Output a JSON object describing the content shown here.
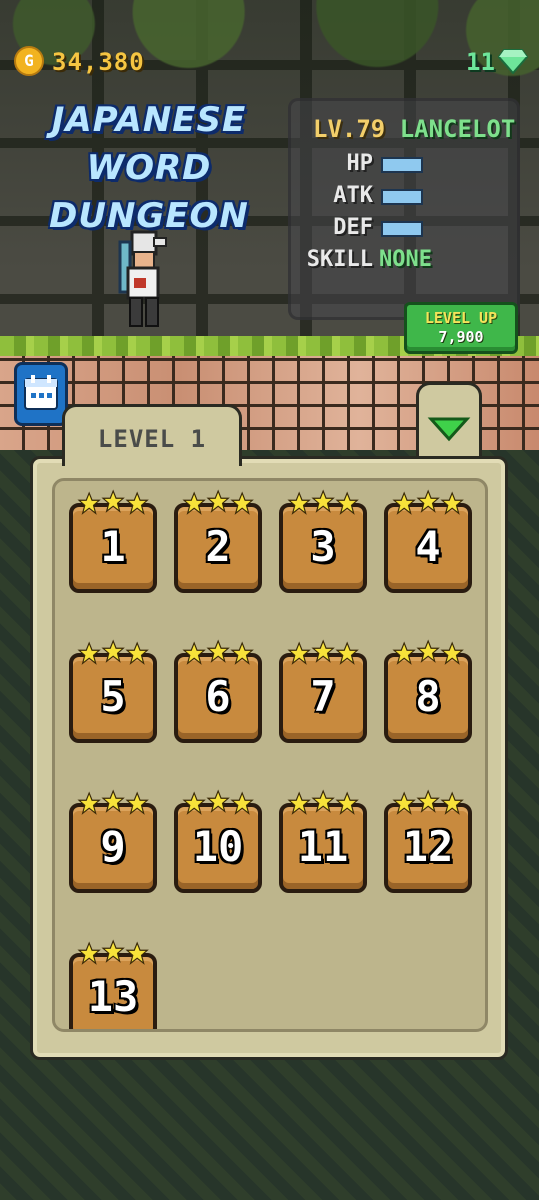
{
  "hud": {
    "coins": "34,380",
    "coin_symbol": "G",
    "gems": "11",
    "title": "JAPANESE WORD DUNGEON"
  },
  "hero": {
    "level": "LV.79",
    "name": "LANCELOT",
    "stats": [
      {
        "label": "HP",
        "kind": "bar"
      },
      {
        "label": "ATK",
        "kind": "bar"
      },
      {
        "label": "DEF",
        "kind": "bar"
      },
      {
        "label": "SKILL",
        "kind": "text",
        "value": "NONE"
      }
    ]
  },
  "level_up": {
    "label": "LEVEL UP",
    "cost": "7,900"
  },
  "panel": {
    "tab_label": "LEVEL 1",
    "levels": [
      {
        "num": "1",
        "stars": 3
      },
      {
        "num": "2",
        "stars": 3
      },
      {
        "num": "3",
        "stars": 3
      },
      {
        "num": "4",
        "stars": 3
      },
      {
        "num": "5",
        "stars": 3
      },
      {
        "num": "6",
        "stars": 3
      },
      {
        "num": "7",
        "stars": 3
      },
      {
        "num": "8",
        "stars": 3
      },
      {
        "num": "9",
        "stars": 3
      },
      {
        "num": "10",
        "stars": 3
      },
      {
        "num": "11",
        "stars": 3
      },
      {
        "num": "12",
        "stars": 3
      },
      {
        "num": "13",
        "stars": 3
      }
    ]
  },
  "icons": {
    "coin": "coin-icon",
    "gem": "gem-icon",
    "calendar": "calendar-icon",
    "dropdown": "triangle-down-icon",
    "star": "star-icon"
  },
  "colors": {
    "coin_text": "#f5c542",
    "gem_text": "#6ee59a",
    "title_text": "#b9e6ff",
    "card": "#c88a3e",
    "star": "#f7e23a",
    "level_up": "#3fb74a"
  }
}
